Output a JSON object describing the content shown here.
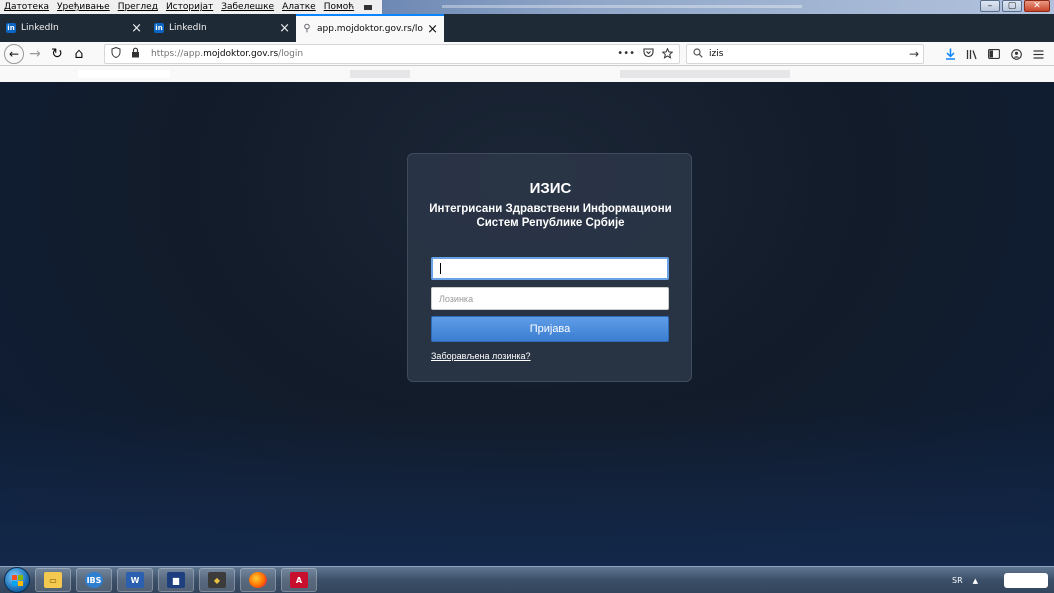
{
  "menubar": {
    "items": [
      "Датотека",
      "Уређивање",
      "Преглед",
      "Историјат",
      "Забелешке",
      "Алатке",
      "Помоћ"
    ]
  },
  "window_controls": {
    "minimize": "–",
    "maximize": "▢",
    "close": "✕"
  },
  "tabs": [
    {
      "title": "LinkedIn",
      "favicon": "linkedin-icon",
      "fav_text": "in",
      "active": false
    },
    {
      "title": "LinkedIn",
      "favicon": "linkedin-icon",
      "fav_text": "in",
      "active": false
    },
    {
      "title": "app.mojdoktor.gov.rs/login",
      "favicon": "globe-icon",
      "fav_text": "⚲",
      "active": true
    }
  ],
  "tab_close_glyph": "×",
  "navbar": {
    "back": "←",
    "forward": "→",
    "reload": "↻",
    "home": "⌂",
    "url_prefix": "https://app.",
    "url_host": "mojdoktor.gov.rs",
    "url_suffix": "/login",
    "page_actions": "•••",
    "search_text": "izis",
    "search_go": "→"
  },
  "login": {
    "app_name": "ИЗИС",
    "subtitle": "Интегрисани Здравствени Информациони Систем Републике Србије",
    "username_value": "",
    "password_placeholder": "Лозинка",
    "login_button": "Пријава",
    "forgot_link": "Заборављена лозинка?"
  },
  "taskbar": {
    "apps": [
      {
        "name": "explorer",
        "glyph": "▭"
      },
      {
        "name": "ibs",
        "glyph": "IBS"
      },
      {
        "name": "word",
        "glyph": "W"
      },
      {
        "name": "save",
        "glyph": "▆"
      },
      {
        "name": "shield",
        "glyph": "◆"
      },
      {
        "name": "firefox",
        "glyph": ""
      },
      {
        "name": "pdf",
        "glyph": "A"
      }
    ],
    "language": "SR",
    "tray_arrow": "▲"
  },
  "colors": {
    "accent": "#0a84ff",
    "login_button": "#4a8cdc",
    "card_bg": "#2a3546",
    "page_bg": "#121b29"
  }
}
